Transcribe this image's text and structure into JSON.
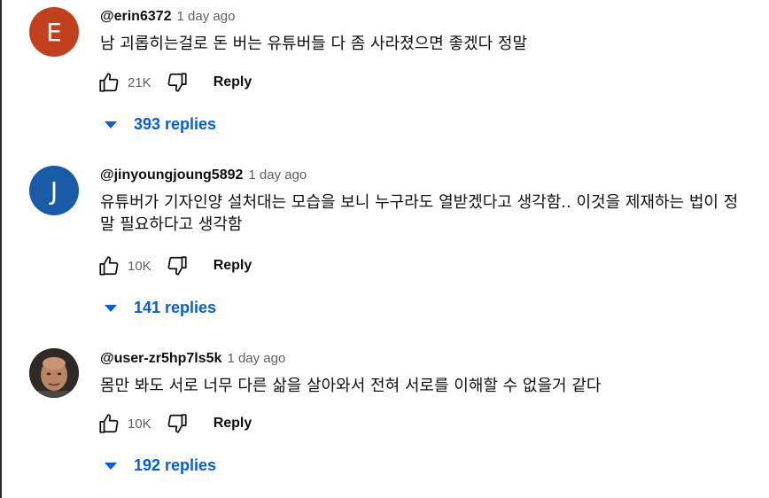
{
  "comments": [
    {
      "avatar_letter": "E",
      "avatar_color": "#c1411f",
      "handle": "@erin6372",
      "time": "1 day ago",
      "text": "남 괴롭히는걸로 돈 버는 유튜버들 다 좀 사라졌으면 좋겠다 정말",
      "likes": "21K",
      "reply_label": "Reply",
      "replies_label": "393 replies"
    },
    {
      "avatar_letter": "J",
      "avatar_color": "#1a5ba8",
      "handle": "@jinyoungjoung5892",
      "time": "1 day ago",
      "text": "유튜버가 기자인양 설처대는 모습을 보니 누구라도 열받겠다고 생각함.. 이것을 제재하는 법이 정말 필요하다고 생각함",
      "likes": "10K",
      "reply_label": "Reply",
      "replies_label": "141 replies"
    },
    {
      "avatar_letter": "",
      "avatar_color": "#6b4a36",
      "handle": "@user-zr5hp7ls5k",
      "time": "1 day ago",
      "text": "몸만 봐도 서로 너무 다른 삶을 살아와서 전혀 서로를 이해할 수 없을거 같다",
      "likes": "10K",
      "reply_label": "Reply",
      "replies_label": "192 replies"
    }
  ],
  "icons": {
    "like": "thumbs-up-icon",
    "dislike": "thumbs-down-icon",
    "expand": "caret-down-icon"
  }
}
